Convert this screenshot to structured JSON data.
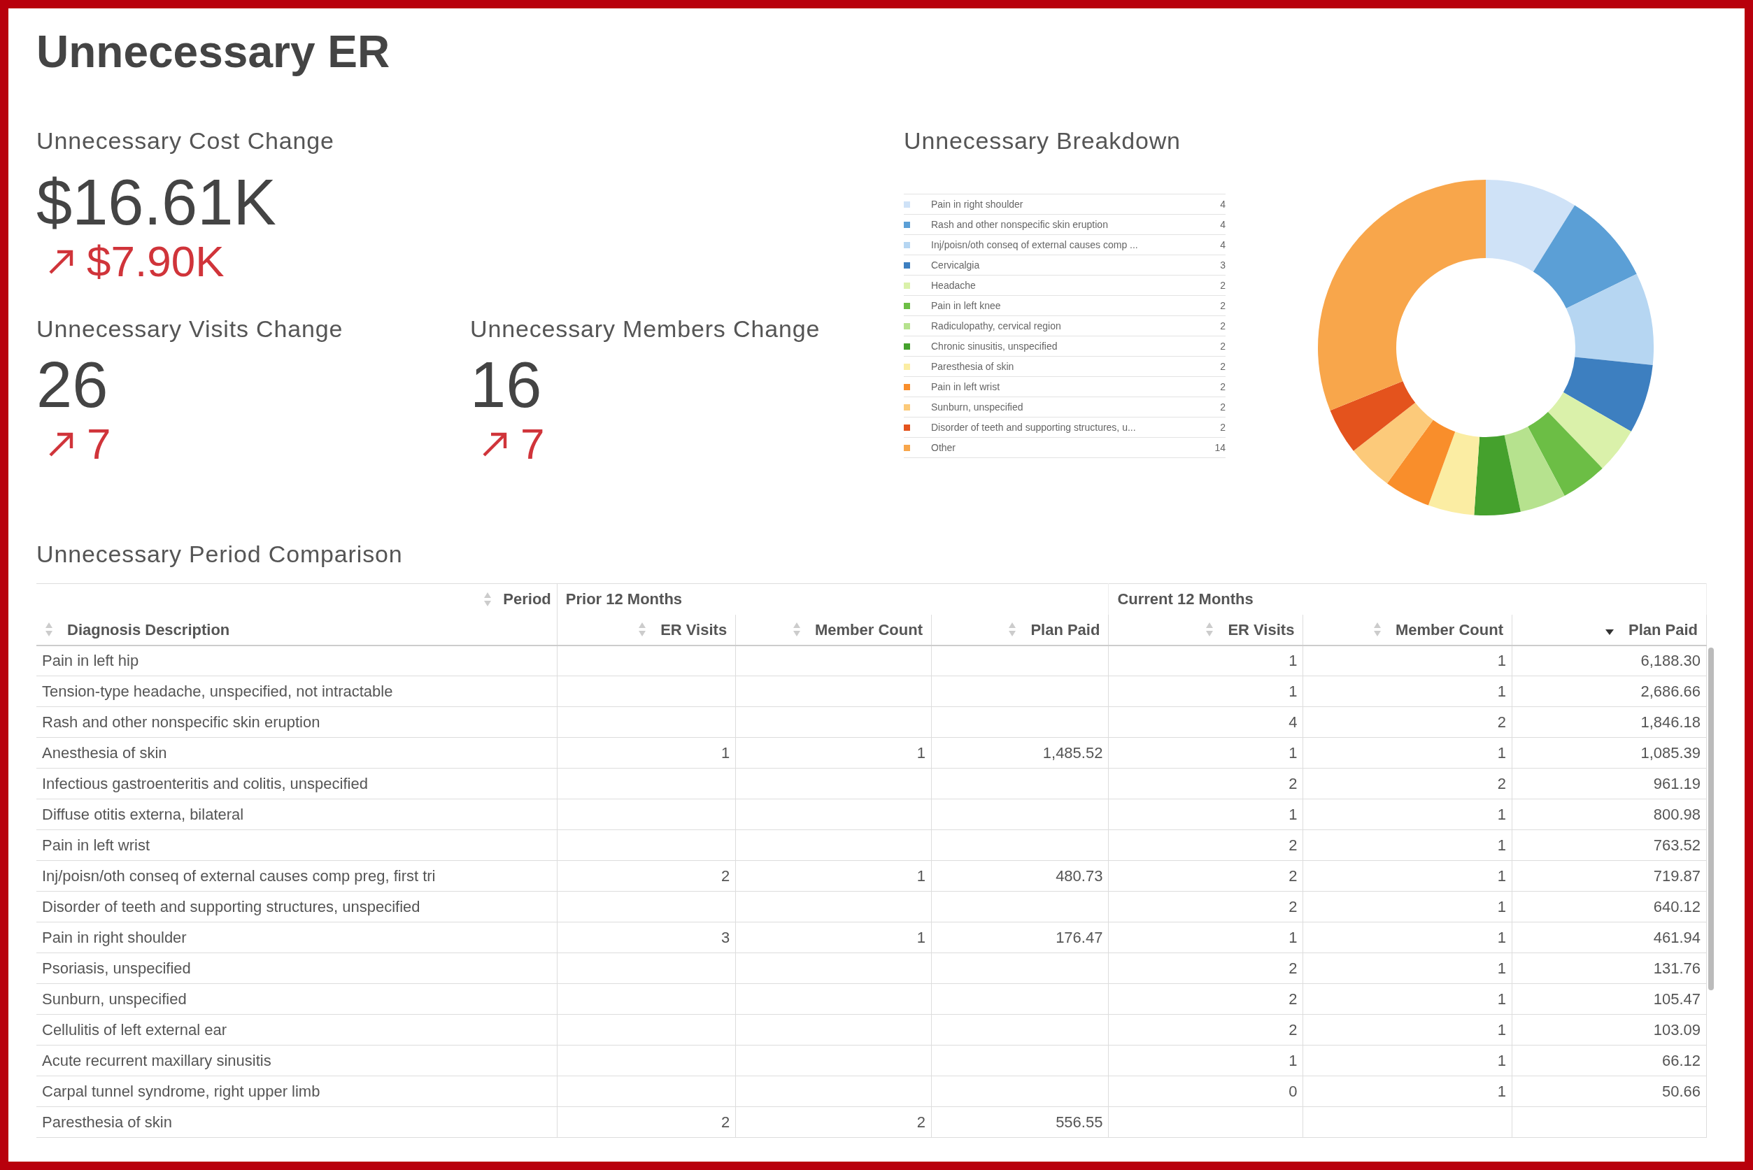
{
  "title": "Unnecessary ER",
  "kpis": [
    {
      "title": "Unnecessary Cost Change",
      "value": "$16.61K",
      "change": "$7.90K"
    },
    {
      "title": "Unnecessary Visits Change",
      "value": "26",
      "change": "7"
    },
    {
      "title": "Unnecessary Members Change",
      "value": "16",
      "change": "7"
    }
  ],
  "breakdown": {
    "title": "Unnecessary Breakdown",
    "legend": [
      {
        "label": "Pain in right shoulder",
        "value": "4",
        "color": "#cfe2f7"
      },
      {
        "label": "Rash and other nonspecific skin eruption",
        "value": "4",
        "color": "#5b9fd6"
      },
      {
        "label": "Inj/poisn/oth conseq of external causes comp ...",
        "value": "4",
        "color": "#b6d6f2"
      },
      {
        "label": "Cervicalgia",
        "value": "3",
        "color": "#3d7fc0"
      },
      {
        "label": "Headache",
        "value": "2",
        "color": "#daf1aa"
      },
      {
        "label": "Pain in left knee",
        "value": "2",
        "color": "#6cbe45"
      },
      {
        "label": "Radiculopathy, cervical region",
        "value": "2",
        "color": "#b6e28e"
      },
      {
        "label": "Chronic sinusitis, unspecified",
        "value": "2",
        "color": "#45a12d"
      },
      {
        "label": "Paresthesia of skin",
        "value": "2",
        "color": "#fbeda3"
      },
      {
        "label": "Pain in left wrist",
        "value": "2",
        "color": "#f98e2b"
      },
      {
        "label": "Sunburn, unspecified",
        "value": "2",
        "color": "#fcca7a"
      },
      {
        "label": "Disorder of teeth and supporting structures, u...",
        "value": "2",
        "color": "#e4531d"
      },
      {
        "label": "Other",
        "value": "14",
        "color": "#f8a64b"
      }
    ]
  },
  "comparison": {
    "title": "Unnecessary Period Comparison",
    "period_header": {
      "label": "Period",
      "sorted": false
    },
    "groups": [
      {
        "label": "Prior 12 Months"
      },
      {
        "label": "Current 12 Months"
      }
    ],
    "columns": [
      {
        "label": "Diagnosis Description",
        "sorted": false
      },
      {
        "label": "ER Visits",
        "sorted": false
      },
      {
        "label": "Member Count",
        "sorted": false
      },
      {
        "label": "Plan Paid",
        "sorted": false
      },
      {
        "label": "ER Visits",
        "sorted": false
      },
      {
        "label": "Member Count",
        "sorted": false
      },
      {
        "label": "Plan Paid",
        "sorted": true
      }
    ],
    "rows": [
      {
        "cells": [
          "Pain in left hip",
          null,
          null,
          null,
          "1",
          "1",
          "6,188.30"
        ]
      },
      {
        "cells": [
          "Tension-type headache, unspecified, not intractable",
          null,
          null,
          null,
          "1",
          "1",
          "2,686.66"
        ]
      },
      {
        "cells": [
          "Rash and other nonspecific skin eruption",
          null,
          null,
          null,
          "4",
          "2",
          "1,846.18"
        ]
      },
      {
        "cells": [
          "Anesthesia of skin",
          "1",
          "1",
          "1,485.52",
          "1",
          "1",
          "1,085.39"
        ]
      },
      {
        "cells": [
          "Infectious gastroenteritis and colitis, unspecified",
          null,
          null,
          null,
          "2",
          "2",
          "961.19"
        ]
      },
      {
        "cells": [
          "Diffuse otitis externa, bilateral",
          null,
          null,
          null,
          "1",
          "1",
          "800.98"
        ]
      },
      {
        "cells": [
          "Pain in left wrist",
          null,
          null,
          null,
          "2",
          "1",
          "763.52"
        ]
      },
      {
        "cells": [
          "Inj/poisn/oth conseq of external causes comp preg, first tri",
          "2",
          "1",
          "480.73",
          "2",
          "1",
          "719.87"
        ]
      },
      {
        "cells": [
          "Disorder of teeth and supporting structures, unspecified",
          null,
          null,
          null,
          "2",
          "1",
          "640.12"
        ]
      },
      {
        "cells": [
          "Pain in right shoulder",
          "3",
          "1",
          "176.47",
          "1",
          "1",
          "461.94"
        ]
      },
      {
        "cells": [
          "Psoriasis, unspecified",
          null,
          null,
          null,
          "2",
          "1",
          "131.76"
        ]
      },
      {
        "cells": [
          "Sunburn, unspecified",
          null,
          null,
          null,
          "2",
          "1",
          "105.47"
        ]
      },
      {
        "cells": [
          "Cellulitis of left external ear",
          null,
          null,
          null,
          "2",
          "1",
          "103.09"
        ]
      },
      {
        "cells": [
          "Acute recurrent maxillary sinusitis",
          null,
          null,
          null,
          "1",
          "1",
          "66.12"
        ]
      },
      {
        "cells": [
          "Carpal tunnel syndrome, right upper limb",
          null,
          null,
          null,
          "0",
          "1",
          "50.66"
        ]
      },
      {
        "cells": [
          "Paresthesia of skin",
          "2",
          "2",
          "556.55",
          null,
          null,
          null
        ]
      }
    ]
  }
}
